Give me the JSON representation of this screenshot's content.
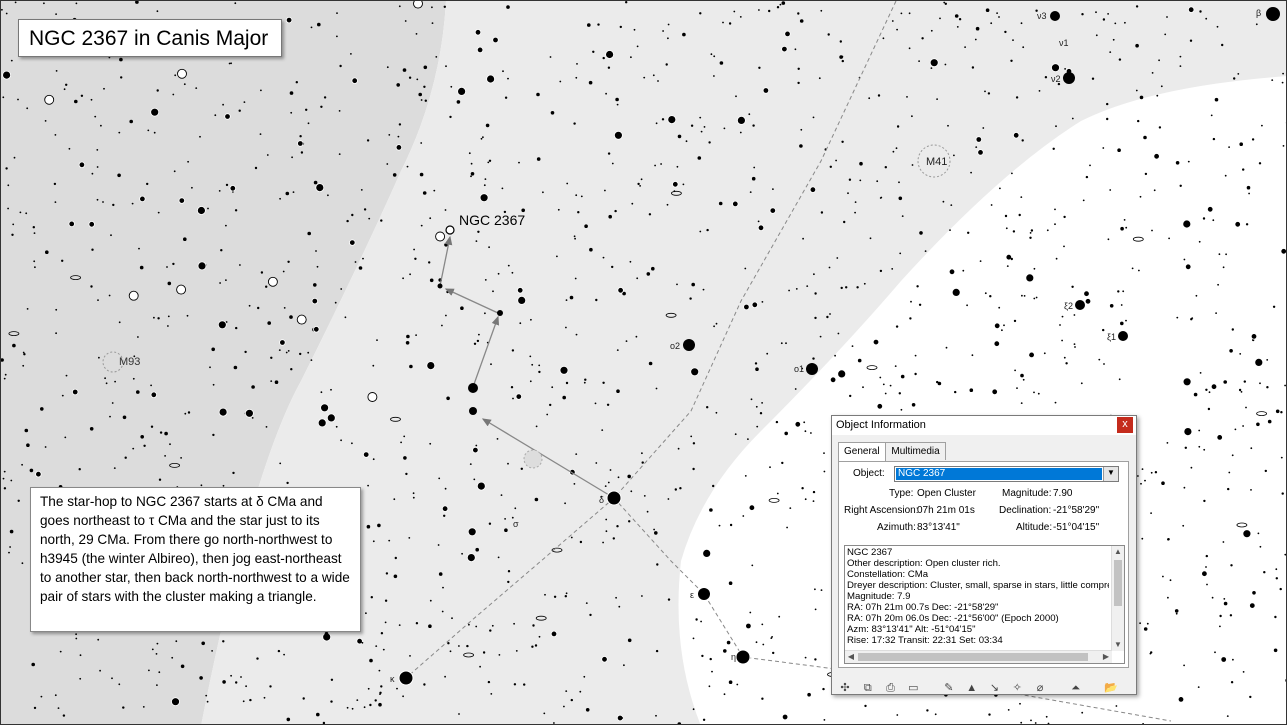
{
  "title": "NGC 2367 in Canis Major",
  "description": "The star-hop to NGC 2367 starts at δ CMa and goes northeast to τ CMa and the star just to its north, 29 CMa.  From there go north-northwest to h3945 (the winter Albireo), then jog east-northeast to another star, then back north-northwest to a wide pair of stars with the cluster making a triangle.",
  "map": {
    "target_label": "NGC 2367",
    "cluster_labels": [
      "M41",
      "M93"
    ],
    "star_labels": [
      "β",
      "ν3",
      "ν1",
      "ν2",
      "o2",
      "o1",
      "ξ2",
      "ξ1",
      "δ",
      "ε",
      "η",
      "σ",
      "κ"
    ]
  },
  "dialog": {
    "title": "Object Information",
    "close": "x",
    "tabs": [
      {
        "label": "General",
        "active": true
      },
      {
        "label": "Multimedia",
        "active": false
      }
    ],
    "object_label": "Object:",
    "object_value": "NGC 2367",
    "type_label": "Type:",
    "type_value": "Open Cluster",
    "magnitude_label": "Magnitude:",
    "magnitude_value": "7.90",
    "ra_label": "Right Ascension:",
    "ra_value": "07h 21m 01s",
    "dec_label": "Declination:",
    "dec_value": "-21°58'29\"",
    "az_label": "Azimuth:",
    "az_value": "83°13'41\"",
    "alt_label": "Altitude:",
    "alt_value": "-51°04'15\"",
    "info_lines": [
      "NGC 2367",
      "Other description: Open cluster rich.",
      "Constellation:  CMa",
      "Dreyer description: Cluster, small, sparse in stars, little compressed",
      "Magnitude:  7.9",
      "RA: 07h 21m 00.7s  Dec: -21°58'29\"",
      "RA: 07h 20m 06.0s  Dec: -21°56'00\"  (Epoch 2000)",
      "Azm: 83°13'41\"  Alt: -51°04'15\"",
      "Rise: 17:32  Transit: 22:31  Set: 03:34"
    ]
  }
}
